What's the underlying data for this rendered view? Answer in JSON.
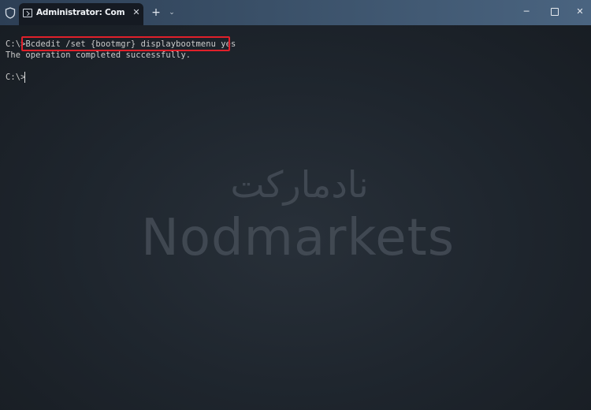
{
  "window": {
    "tab_title": "Administrator: Command Prompt",
    "close_tab_glyph": "✕",
    "new_tab_glyph": "+",
    "dropdown_glyph": "⌄",
    "minimize_glyph": "─",
    "close_glyph": "✕"
  },
  "console": {
    "lines": [
      {
        "prompt": "C:\\>",
        "command": "Bcdedit /set {bootmgr} displaybootmenu yes"
      },
      {
        "output": "The operation completed successfully."
      },
      {
        "prompt": "C:\\>",
        "command": ""
      }
    ],
    "highlight_color": "#e0202a"
  },
  "watermark": {
    "arabic": "نادمارکت",
    "latin": "Nodmarkets"
  },
  "icons": {
    "shield": "shield-icon",
    "terminal": "terminal-icon",
    "close_tab": "close-icon",
    "new_tab": "plus-icon",
    "dropdown": "chevron-down-icon",
    "minimize": "minimize-icon",
    "maximize": "maximize-icon",
    "close": "close-icon"
  }
}
